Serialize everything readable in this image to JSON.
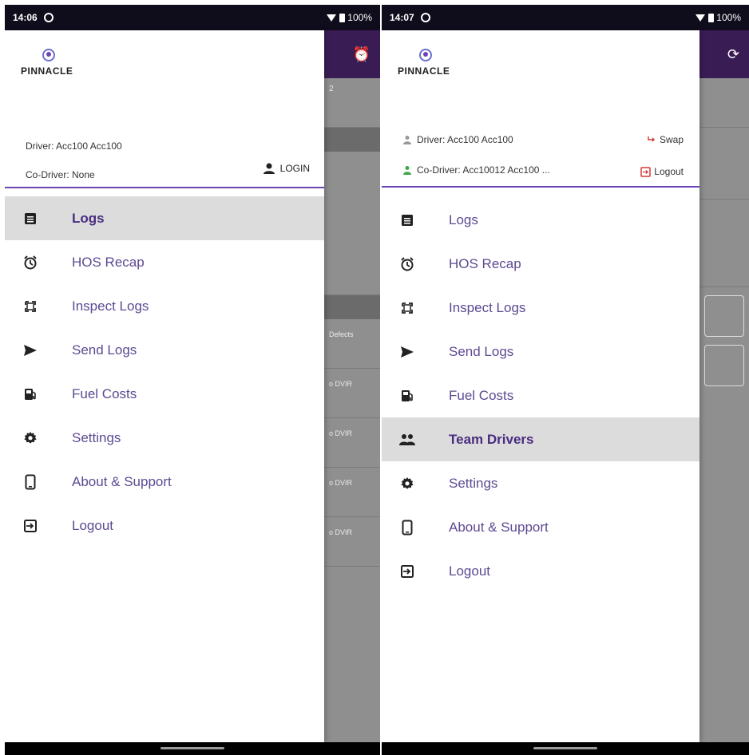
{
  "colors": {
    "accent": "#6b45b5",
    "label": "#5d4a92",
    "appbar": "#3a1c55",
    "statusbar": "#0f0c1c",
    "green": "#3aa84a",
    "red": "#d23b3b"
  },
  "left": {
    "status": {
      "time": "14:06",
      "battery": "100%"
    },
    "brand": "PINNACLE",
    "driver": "Driver: Acc100 Acc100",
    "codriver": "Co-Driver: None",
    "login_label": "LOGIN",
    "menu": [
      {
        "label": "Logs",
        "icon": "logs-icon",
        "active": true
      },
      {
        "label": "HOS Recap",
        "icon": "alarm-icon",
        "active": false
      },
      {
        "label": "Inspect Logs",
        "icon": "inspect-icon",
        "active": false
      },
      {
        "label": "Send Logs",
        "icon": "send-icon",
        "active": false
      },
      {
        "label": "Fuel Costs",
        "icon": "fuel-icon",
        "active": false
      },
      {
        "label": "Settings",
        "icon": "gear-icon",
        "active": false
      },
      {
        "label": "About & Support",
        "icon": "phone-icon",
        "active": false
      },
      {
        "label": "Logout",
        "icon": "logout-icon",
        "active": false
      }
    ],
    "background": {
      "counter": "2",
      "defects": "Defects",
      "dvir_1": "o DVIR",
      "dvir_2": "o DVIR",
      "dvir_3": "o DVIR",
      "dvir_4": "o DVIR"
    }
  },
  "right": {
    "status": {
      "time": "14:07",
      "battery": "100%"
    },
    "brand": "PINNACLE",
    "driver": "Driver: Acc100 Acc100",
    "codriver": "Co-Driver: Acc10012 Acc100 ...",
    "swap_label": "Swap",
    "logout_label": "Logout",
    "menu": [
      {
        "label": "Logs",
        "icon": "logs-icon",
        "active": false
      },
      {
        "label": "HOS Recap",
        "icon": "alarm-icon",
        "active": false
      },
      {
        "label": "Inspect Logs",
        "icon": "inspect-icon",
        "active": false
      },
      {
        "label": "Send Logs",
        "icon": "send-icon",
        "active": false
      },
      {
        "label": "Fuel Costs",
        "icon": "fuel-icon",
        "active": false
      },
      {
        "label": "Team Drivers",
        "icon": "team-icon",
        "active": true
      },
      {
        "label": "Settings",
        "icon": "gear-icon",
        "active": false
      },
      {
        "label": "About & Support",
        "icon": "phone-icon",
        "active": false
      },
      {
        "label": "Logout",
        "icon": "logout-icon",
        "active": false
      }
    ]
  }
}
